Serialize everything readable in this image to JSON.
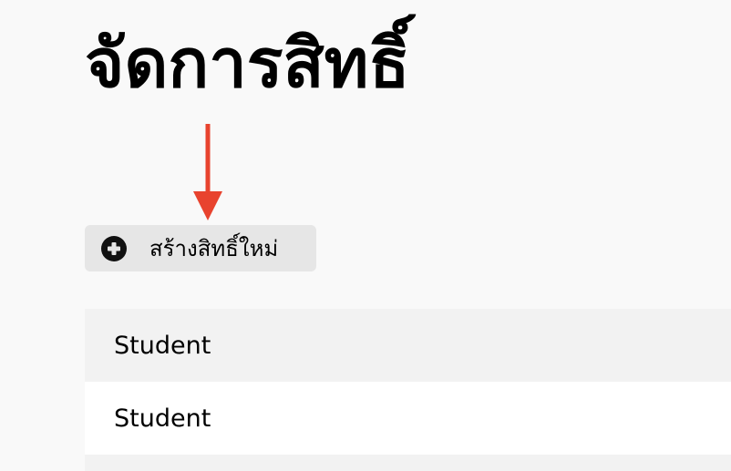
{
  "page": {
    "title": "จัดการสิทธิ์"
  },
  "toolbar": {
    "create_label": "สร้างสิทธิ์ใหม่",
    "create_icon": "plus-circle-icon"
  },
  "annotation": {
    "arrow_icon": "down-arrow-icon",
    "arrow_color": "#e8432e"
  },
  "roles": {
    "items": [
      {
        "label": "Student"
      },
      {
        "label": "Student"
      },
      {
        "label": ""
      }
    ]
  }
}
